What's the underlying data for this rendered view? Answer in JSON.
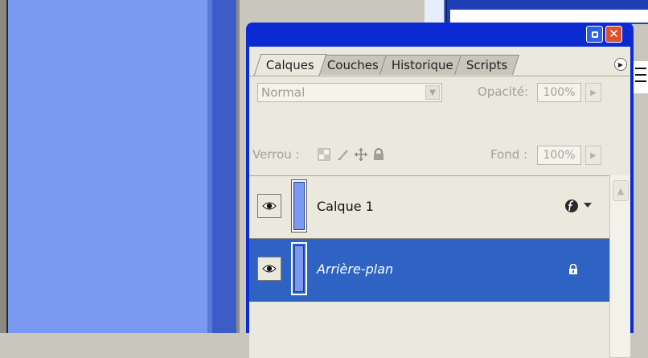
{
  "tabs": [
    "Calques",
    "Couches",
    "Historique",
    "Scripts"
  ],
  "blend_mode": "Normal",
  "opacity_label": "Opacité:",
  "opacity_value": "100%",
  "lock_label": "Verrou :",
  "fill_label": "Fond :",
  "fill_value": "100%",
  "layers": [
    {
      "name": "Calque 1",
      "visible": true,
      "selected": false,
      "has_effects": true
    },
    {
      "name": "Arrière-plan",
      "visible": true,
      "selected": true,
      "locked": true
    }
  ],
  "icons": {
    "minimize": "minimize-icon",
    "close": "close-icon",
    "palette_menu": "palette-menu-icon",
    "eye": "eye-icon",
    "lock_transparency": "lock-transparent-pixels-icon",
    "lock_paint": "lock-image-pixels-icon",
    "lock_move": "lock-position-icon",
    "lock_all": "lock-all-icon",
    "effects": "layer-effects-icon"
  },
  "colors": {
    "title_bar": "#0b2ad1",
    "selected_row": "#2e63c4",
    "canvas": "#7a9af2"
  }
}
